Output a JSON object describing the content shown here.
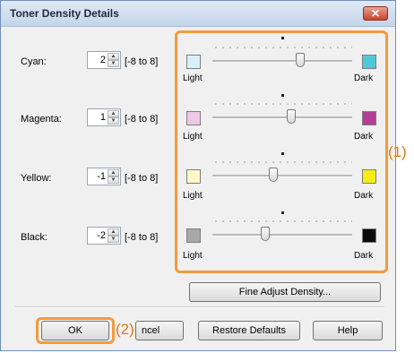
{
  "dialog": {
    "title": "Toner Density Details",
    "close_label": "✕"
  },
  "rows": [
    {
      "label": "Cyan:",
      "value": "2",
      "range": "[-8 to 8]",
      "color": "#4fc9d6",
      "light_color": "#d8f1f6",
      "level": 2
    },
    {
      "label": "Magenta:",
      "value": "1",
      "range": "[-8 to 8]",
      "color": "#b23f95",
      "light_color": "#efc8e5",
      "level": 1
    },
    {
      "label": "Yellow:",
      "value": "-1",
      "range": "[-8 to 8]",
      "color": "#f7ed15",
      "light_color": "#fdf8c6",
      "level": -1
    },
    {
      "label": "Black:",
      "value": "-2",
      "range": "[-8 to 8]",
      "color": "#0a0a0a",
      "light_color": "#a8a8a8",
      "level": -2
    }
  ],
  "slider_labels": {
    "light": "Light",
    "dark": "Dark"
  },
  "buttons": {
    "fine_adjust": "Fine Adjust Density...",
    "ok": "OK",
    "cancel": "ncel",
    "restore": "Restore Defaults",
    "help": "Help"
  },
  "callouts": {
    "one": "(1)",
    "two": "(2)"
  },
  "colors": {
    "highlight": "#f39a3c",
    "callout": "#e07b12"
  }
}
